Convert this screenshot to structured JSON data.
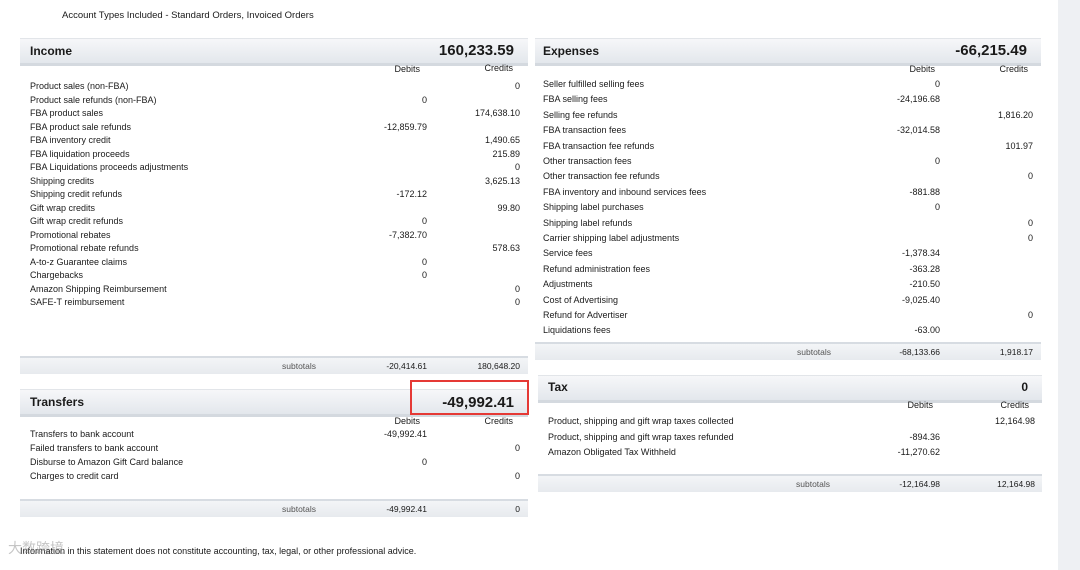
{
  "account_types": "Account Types Included - Standard Orders, Invoiced Orders",
  "column_headers": {
    "debits": "Debits",
    "credits": "Credits"
  },
  "income": {
    "title": "Income",
    "total": "160,233.59",
    "rows": [
      {
        "label": "Product sales (non-FBA)",
        "debit": "",
        "credit": "0"
      },
      {
        "label": "Product sale refunds (non-FBA)",
        "debit": "0",
        "credit": ""
      },
      {
        "label": "FBA product sales",
        "debit": "",
        "credit": "174,638.10"
      },
      {
        "label": "FBA product sale refunds",
        "debit": "-12,859.79",
        "credit": ""
      },
      {
        "label": "FBA inventory credit",
        "debit": "",
        "credit": "1,490.65"
      },
      {
        "label": "FBA liquidation proceeds",
        "debit": "",
        "credit": "215.89"
      },
      {
        "label": "FBA Liquidations proceeds adjustments",
        "debit": "",
        "credit": "0"
      },
      {
        "label": "Shipping credits",
        "debit": "",
        "credit": "3,625.13"
      },
      {
        "label": "Shipping credit refunds",
        "debit": "-172.12",
        "credit": ""
      },
      {
        "label": "Gift wrap credits",
        "debit": "",
        "credit": "99.80"
      },
      {
        "label": "Gift wrap credit refunds",
        "debit": "0",
        "credit": ""
      },
      {
        "label": "Promotional rebates",
        "debit": "-7,382.70",
        "credit": ""
      },
      {
        "label": "Promotional rebate refunds",
        "debit": "",
        "credit": "578.63"
      },
      {
        "label": "A-to-z Guarantee claims",
        "debit": "0",
        "credit": ""
      },
      {
        "label": "Chargebacks",
        "debit": "0",
        "credit": ""
      },
      {
        "label": "Amazon Shipping Reimbursement",
        "debit": "",
        "credit": "0"
      },
      {
        "label": "SAFE-T reimbursement",
        "debit": "",
        "credit": "0"
      }
    ],
    "subtotal_label": "subtotals",
    "subtotal_debit": "-20,414.61",
    "subtotal_credit": "180,648.20"
  },
  "transfers": {
    "title": "Transfers",
    "total": "-49,992.41",
    "rows": [
      {
        "label": "Transfers to bank account",
        "debit": "-49,992.41",
        "credit": ""
      },
      {
        "label": "Failed transfers to bank account",
        "debit": "",
        "credit": "0"
      },
      {
        "label": "Disburse to Amazon Gift Card balance",
        "debit": "0",
        "credit": ""
      },
      {
        "label": "Charges to credit card",
        "debit": "",
        "credit": "0"
      }
    ],
    "subtotal_label": "subtotals",
    "subtotal_debit": "-49,992.41",
    "subtotal_credit": "0"
  },
  "expenses": {
    "title": "Expenses",
    "total": "-66,215.49",
    "rows": [
      {
        "label": "Seller fulfilled selling fees",
        "debit": "0",
        "credit": ""
      },
      {
        "label": "FBA selling fees",
        "debit": "-24,196.68",
        "credit": ""
      },
      {
        "label": "Selling fee refunds",
        "debit": "",
        "credit": "1,816.20"
      },
      {
        "label": "FBA transaction fees",
        "debit": "-32,014.58",
        "credit": ""
      },
      {
        "label": "FBA transaction fee refunds",
        "debit": "",
        "credit": "101.97"
      },
      {
        "label": "Other transaction fees",
        "debit": "0",
        "credit": ""
      },
      {
        "label": "Other transaction fee refunds",
        "debit": "",
        "credit": "0"
      },
      {
        "label": "FBA inventory and inbound services fees",
        "debit": "-881.88",
        "credit": ""
      },
      {
        "label": "Shipping label purchases",
        "debit": "0",
        "credit": ""
      },
      {
        "label": "Shipping label refunds",
        "debit": "",
        "credit": "0"
      },
      {
        "label": "Carrier shipping label adjustments",
        "debit": "",
        "credit": "0"
      },
      {
        "label": "Service fees",
        "debit": "-1,378.34",
        "credit": ""
      },
      {
        "label": "Refund administration fees",
        "debit": "-363.28",
        "credit": ""
      },
      {
        "label": "Adjustments",
        "debit": "-210.50",
        "credit": ""
      },
      {
        "label": "Cost of Advertising",
        "debit": "-9,025.40",
        "credit": ""
      },
      {
        "label": "Refund for Advertiser",
        "debit": "",
        "credit": "0"
      },
      {
        "label": "Liquidations fees",
        "debit": "-63.00",
        "credit": ""
      }
    ],
    "subtotal_label": "subtotals",
    "subtotal_debit": "-68,133.66",
    "subtotal_credit": "1,918.17"
  },
  "tax": {
    "title": "Tax",
    "total": "0",
    "rows": [
      {
        "label": "Product, shipping and gift wrap taxes collected",
        "debit": "",
        "credit": "12,164.98"
      },
      {
        "label": "Product, shipping and gift wrap taxes refunded",
        "debit": "-894.36",
        "credit": ""
      },
      {
        "label": "Amazon Obligated Tax Withheld",
        "debit": "-11,270.62",
        "credit": ""
      }
    ],
    "subtotal_label": "subtotals",
    "subtotal_debit": "-12,164.98",
    "subtotal_credit": "12,164.98"
  },
  "footer": "Information in this statement does not constitute accounting, tax, legal, or other professional advice.",
  "watermark": "大数跨境",
  "colors": {
    "highlight": "#e53935"
  }
}
